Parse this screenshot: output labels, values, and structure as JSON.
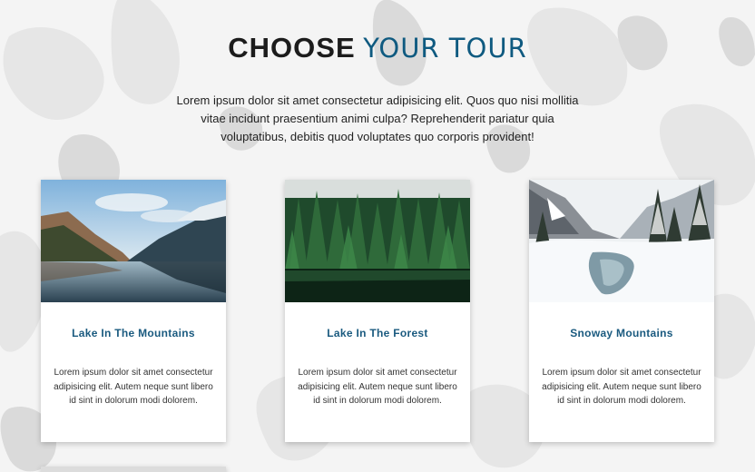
{
  "heading": {
    "strong": "CHOOSE",
    "light": "YOUR TOUR"
  },
  "intro": "Lorem ipsum dolor sit amet consectetur adipisicing elit. Quos quo nisi mollitia vitae incidunt praesentium animi culpa? Reprehenderit pariatur quia voluptatibus, debitis quod voluptates quo corporis provident!",
  "cards": [
    {
      "title": "Lake In The Mountains",
      "text": "Lorem ipsum dolor sit amet consectetur adipisicing elit. Autem neque sunt libero id sint in dolorum modi dolorem."
    },
    {
      "title": "Lake In The Forest",
      "text": "Lorem ipsum dolor sit amet consectetur adipisicing elit. Autem neque sunt libero id sint in dolorum modi dolorem."
    },
    {
      "title": "Snoway Mountains",
      "text": "Lorem ipsum dolor sit amet consectetur adipisicing elit. Autem neque sunt libero id sint in dolorum modi dolorem."
    }
  ],
  "colors": {
    "accent": "#0f5a80",
    "card_title": "#1a5a7f",
    "heading_dark": "#1c1c1c"
  }
}
